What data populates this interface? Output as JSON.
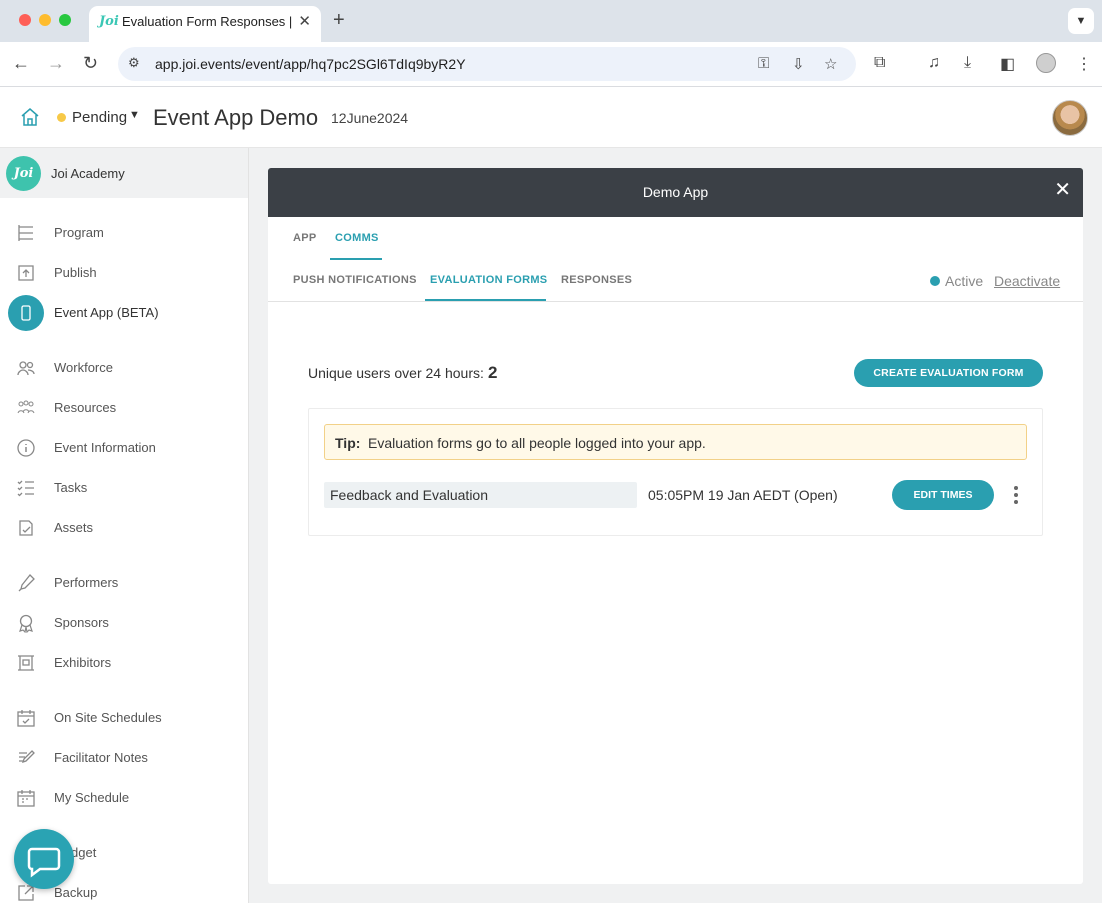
{
  "browser": {
    "tab_title": "Evaluation Form Responses |",
    "tab_favicon": "Joi",
    "url": "app.joi.events/event/app/hq7pc2SGl6TdIq9byR2Y"
  },
  "header": {
    "status": "Pending",
    "event_title": "Event App Demo",
    "event_date": "12June2024"
  },
  "sidebar": {
    "org_logo": "Joi",
    "org_name": "Joi Academy",
    "items": [
      {
        "label": "Program",
        "icon": "program-icon"
      },
      {
        "label": "Publish",
        "icon": "publish-icon"
      },
      {
        "label": "Event App (BETA)",
        "icon": "phone-icon",
        "active": true
      },
      {
        "label": "Workforce",
        "icon": "people-icon"
      },
      {
        "label": "Resources",
        "icon": "resources-icon"
      },
      {
        "label": "Event Information",
        "icon": "info-icon"
      },
      {
        "label": "Tasks",
        "icon": "tasks-icon"
      },
      {
        "label": "Assets",
        "icon": "assets-icon"
      },
      {
        "label": "Performers",
        "icon": "mic-icon"
      },
      {
        "label": "Sponsors",
        "icon": "badge-icon"
      },
      {
        "label": "Exhibitors",
        "icon": "exhibitor-icon"
      },
      {
        "label": "On Site Schedules",
        "icon": "calendar-check-icon"
      },
      {
        "label": "Facilitator Notes",
        "icon": "notes-icon"
      },
      {
        "label": "My Schedule",
        "icon": "calendar-icon"
      },
      {
        "label": "dget",
        "icon": "budget-icon"
      },
      {
        "label": "Backup",
        "icon": "backup-icon"
      }
    ]
  },
  "panel": {
    "title": "Demo App",
    "tabs": [
      "APP",
      "COMMS"
    ],
    "subtabs": [
      "PUSH NOTIFICATIONS",
      "EVALUATION FORMS",
      "RESPONSES"
    ],
    "active_status": "Active",
    "deactivate": "Deactivate",
    "unique_users_label": "Unique users over 24 hours:",
    "unique_users_count": "2",
    "create_button": "CREATE EVALUATION FORM",
    "tip_label": "Tip:",
    "tip_text": "Evaluation forms go to all people logged into your app.",
    "form": {
      "name": "Feedback and Evaluation",
      "times": "05:05PM 19 Jan AEDT (Open)",
      "edit_button": "EDIT TIMES"
    }
  },
  "colors": {
    "accent": "#2a9fb0",
    "header_dark": "#3b4046",
    "pending": "#f7c948",
    "tip_bg": "#fff9e8"
  }
}
